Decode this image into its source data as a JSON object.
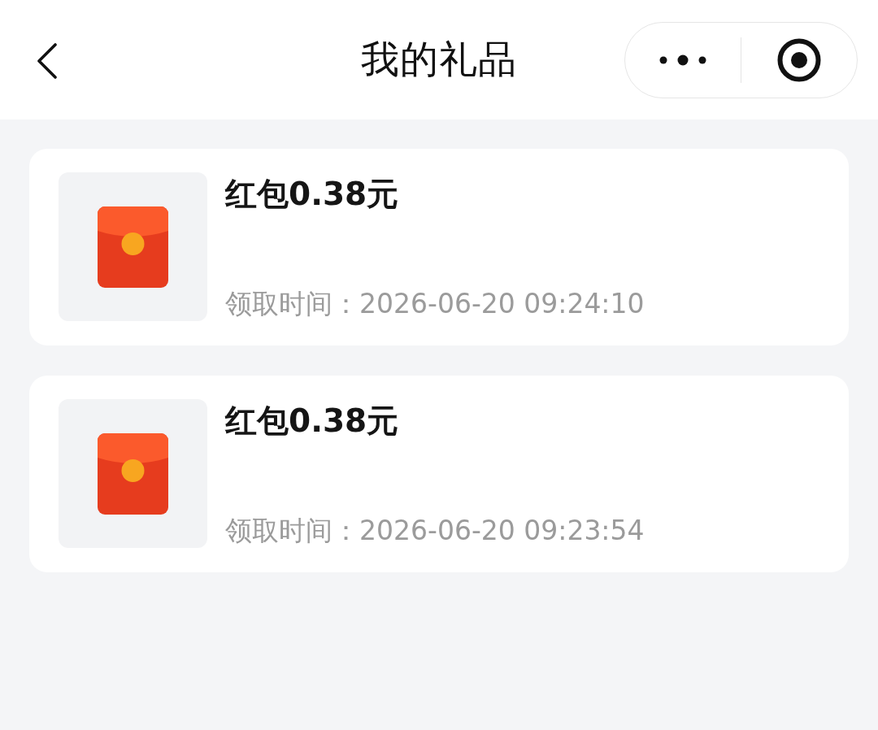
{
  "header": {
    "title": "我的礼品"
  },
  "gifts": [
    {
      "name": "红包0.38元",
      "received": "领取时间：2026-06-20 09:24:10"
    },
    {
      "name": "红包0.38元",
      "received": "领取时间：2026-06-20 09:23:54"
    }
  ]
}
